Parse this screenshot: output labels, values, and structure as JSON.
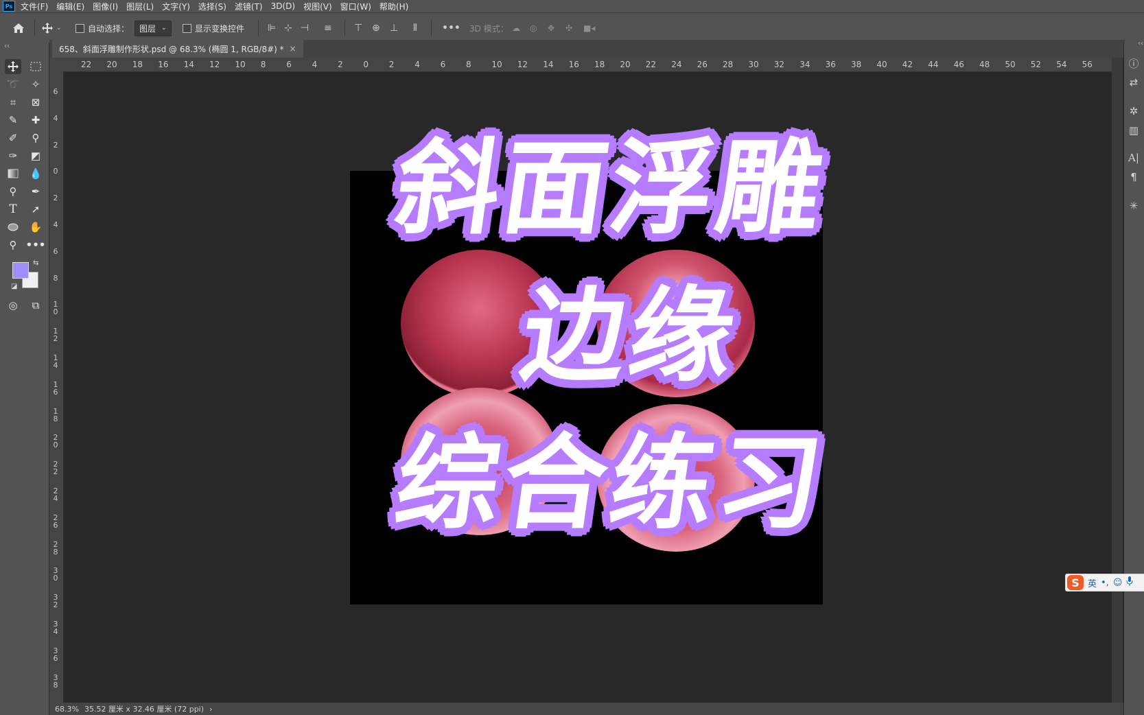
{
  "app": {
    "logo": "Ps"
  },
  "menu": [
    "文件(F)",
    "编辑(E)",
    "图像(I)",
    "图层(L)",
    "文字(Y)",
    "选择(S)",
    "滤镜(T)",
    "3D(D)",
    "视图(V)",
    "窗口(W)",
    "帮助(H)"
  ],
  "options": {
    "auto_select_label": "自动选择：",
    "auto_select_value": "图层",
    "show_transform_label": "显示变换控件",
    "mode_3d_label": "3D 模式："
  },
  "document": {
    "tab_title": "658、斜面浮雕制作形状.psd @ 68.3% (椭圆 1, RGB/8#) *",
    "close_glyph": "×"
  },
  "ruler": {
    "horizontal": [
      "22",
      "20",
      "18",
      "16",
      "14",
      "12",
      "10",
      "8",
      "6",
      "4",
      "2",
      "0",
      "2",
      "4",
      "6",
      "8",
      "10",
      "12",
      "14",
      "16",
      "18",
      "20",
      "22",
      "24",
      "26",
      "28",
      "30",
      "32",
      "34",
      "36",
      "38",
      "40",
      "42",
      "44",
      "46",
      "48",
      "50",
      "52",
      "54",
      "56"
    ],
    "vertical": [
      "6",
      "4",
      "2",
      "0",
      "2",
      "4",
      "6",
      "8",
      "10",
      "12",
      "14",
      "16",
      "18",
      "20",
      "22",
      "24",
      "26",
      "28",
      "30",
      "32",
      "34",
      "36",
      "38"
    ]
  },
  "headline": {
    "line1": "斜面浮雕",
    "line2": "边缘",
    "line3": "综合练习",
    "fill_color": "#ffffff",
    "stroke_color": "#b67cff"
  },
  "colors": {
    "foreground": "#a08cff",
    "background": "#f0f0f0",
    "ball": "#c8435e"
  },
  "status": {
    "zoom": "68.3%",
    "doc_size": "35.52 厘米 x 32.46 厘米 (72 ppi)",
    "arrow": "›"
  },
  "ime": {
    "logo": "S",
    "lang": "英",
    "punct": "•,",
    "emoji": "☺",
    "mic": "🎤"
  },
  "icons": {
    "home": "home-icon",
    "move": "move-icon",
    "marquee": "rect-marquee-icon",
    "lasso": "lasso-icon",
    "magic_wand": "magic-wand-icon",
    "crop": "crop-icon",
    "frame": "frame-icon",
    "eyedropper": "eyedropper-icon",
    "healing": "healing-brush-icon",
    "brush": "brush-icon",
    "stamp": "clone-stamp-icon",
    "history_brush": "history-brush-icon",
    "eraser": "eraser-icon",
    "gradient": "gradient-icon",
    "blur": "blur-icon",
    "dodge": "dodge-icon",
    "pen": "pen-icon",
    "type": "type-icon",
    "path_select": "path-select-icon",
    "ellipse": "ellipse-icon",
    "hand": "hand-icon",
    "zoom": "zoom-icon",
    "more": "more-icon"
  }
}
